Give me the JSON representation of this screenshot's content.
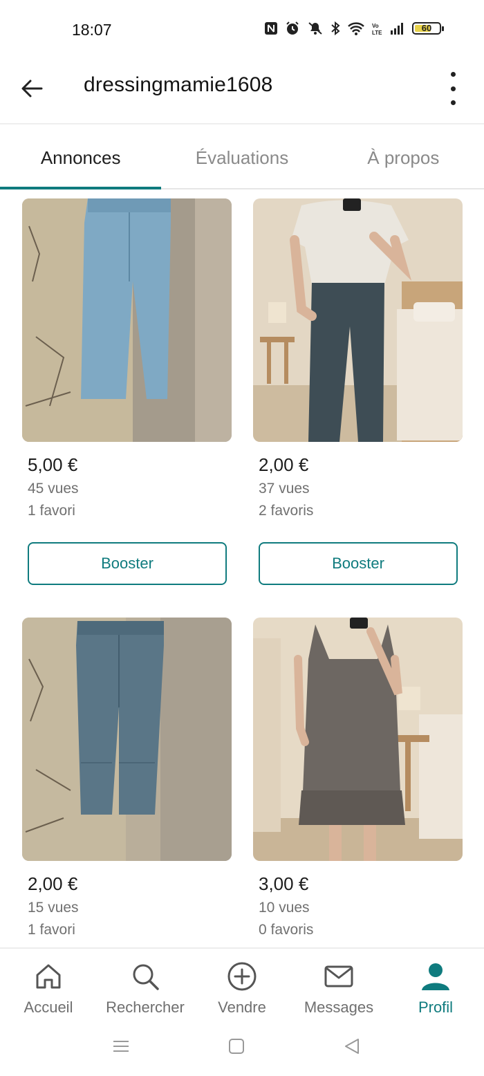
{
  "status_bar": {
    "time": "18:07",
    "battery": "60"
  },
  "header": {
    "username": "dressingmamie1608"
  },
  "tabs": [
    {
      "label": "Annonces",
      "active": true
    },
    {
      "label": "Évaluations",
      "active": false
    },
    {
      "label": "À propos",
      "active": false
    }
  ],
  "listings": [
    {
      "price": "5,00 €",
      "views": "45 vues",
      "favorites": "1 favori",
      "button": "Booster",
      "photo": "light blue jeans hanging on stone wall"
    },
    {
      "price": "2,00 €",
      "views": "37 vues",
      "favorites": "2 favoris",
      "button": "Booster",
      "photo": "person wearing dark jeans and white t-shirt"
    },
    {
      "price": "2,00 €",
      "views": "15 vues",
      "favorites": "1 favori",
      "button": "",
      "photo": "grey-blue jeans hanging on stone wall"
    },
    {
      "price": "3,00 €",
      "views": "10 vues",
      "favorites": "0 favoris",
      "button": "",
      "photo": "person wearing grey sleeveless dress"
    }
  ],
  "bottom_nav": [
    {
      "label": "Accueil",
      "icon": "home-icon",
      "active": false
    },
    {
      "label": "Rechercher",
      "icon": "search-icon",
      "active": false
    },
    {
      "label": "Vendre",
      "icon": "plus-circle-icon",
      "active": false
    },
    {
      "label": "Messages",
      "icon": "mail-icon",
      "active": false
    },
    {
      "label": "Profil",
      "icon": "person-icon",
      "active": true
    }
  ],
  "colors": {
    "accent": "#0f7b7e",
    "text": "#1c1c1c",
    "muted": "#707070"
  }
}
